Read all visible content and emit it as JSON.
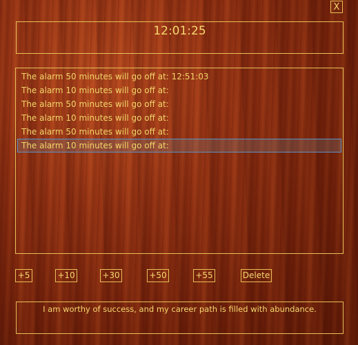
{
  "window": {
    "close_label": "X"
  },
  "clock": {
    "time": "12:01:25"
  },
  "alarms": [
    {
      "text": "The alarm 50 minutes will go off at: 12:51:03"
    },
    {
      "text": "The alarm 10 minutes will go off at:"
    },
    {
      "text": "The alarm 50 minutes will go off at:"
    },
    {
      "text": "The alarm 10 minutes will go off at:"
    },
    {
      "text": "The alarm 50 minutes will go off at:"
    },
    {
      "text": "The alarm 10 minutes will go off at:",
      "selected": true
    }
  ],
  "buttons": {
    "plus5": "+5",
    "plus10": "+10",
    "plus30": "+30",
    "plus50": "+50",
    "plus55": "+55",
    "delete": "Delete"
  },
  "affirmation": "I am worthy of success, and my career path is filled with abundance.",
  "colors": {
    "text": "#f6d870",
    "border": "#e8c25a",
    "selection_border": "#5a93c8"
  }
}
